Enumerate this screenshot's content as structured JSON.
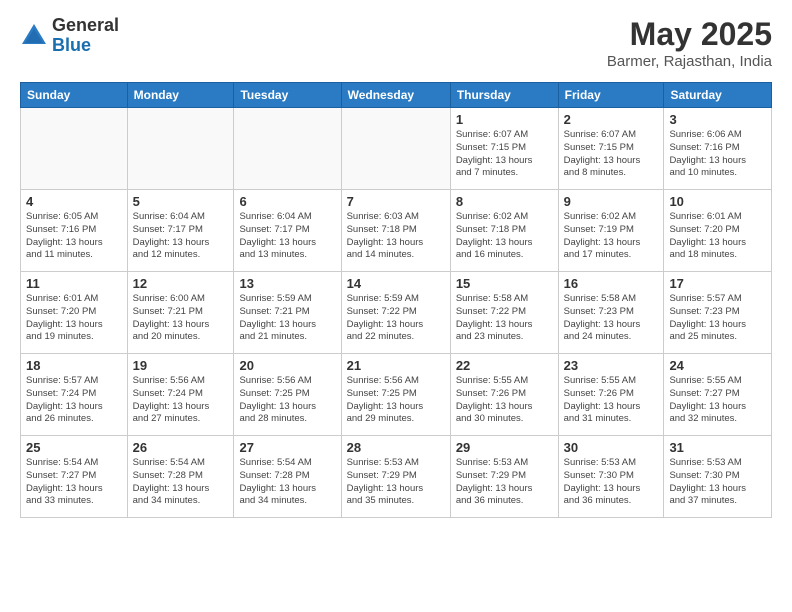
{
  "header": {
    "logo_general": "General",
    "logo_blue": "Blue",
    "month_title": "May 2025",
    "location": "Barmer, Rajasthan, India"
  },
  "weekdays": [
    "Sunday",
    "Monday",
    "Tuesday",
    "Wednesday",
    "Thursday",
    "Friday",
    "Saturday"
  ],
  "weeks": [
    [
      {
        "day": "",
        "info": ""
      },
      {
        "day": "",
        "info": ""
      },
      {
        "day": "",
        "info": ""
      },
      {
        "day": "",
        "info": ""
      },
      {
        "day": "1",
        "info": "Sunrise: 6:07 AM\nSunset: 7:15 PM\nDaylight: 13 hours\nand 7 minutes."
      },
      {
        "day": "2",
        "info": "Sunrise: 6:07 AM\nSunset: 7:15 PM\nDaylight: 13 hours\nand 8 minutes."
      },
      {
        "day": "3",
        "info": "Sunrise: 6:06 AM\nSunset: 7:16 PM\nDaylight: 13 hours\nand 10 minutes."
      }
    ],
    [
      {
        "day": "4",
        "info": "Sunrise: 6:05 AM\nSunset: 7:16 PM\nDaylight: 13 hours\nand 11 minutes."
      },
      {
        "day": "5",
        "info": "Sunrise: 6:04 AM\nSunset: 7:17 PM\nDaylight: 13 hours\nand 12 minutes."
      },
      {
        "day": "6",
        "info": "Sunrise: 6:04 AM\nSunset: 7:17 PM\nDaylight: 13 hours\nand 13 minutes."
      },
      {
        "day": "7",
        "info": "Sunrise: 6:03 AM\nSunset: 7:18 PM\nDaylight: 13 hours\nand 14 minutes."
      },
      {
        "day": "8",
        "info": "Sunrise: 6:02 AM\nSunset: 7:18 PM\nDaylight: 13 hours\nand 16 minutes."
      },
      {
        "day": "9",
        "info": "Sunrise: 6:02 AM\nSunset: 7:19 PM\nDaylight: 13 hours\nand 17 minutes."
      },
      {
        "day": "10",
        "info": "Sunrise: 6:01 AM\nSunset: 7:20 PM\nDaylight: 13 hours\nand 18 minutes."
      }
    ],
    [
      {
        "day": "11",
        "info": "Sunrise: 6:01 AM\nSunset: 7:20 PM\nDaylight: 13 hours\nand 19 minutes."
      },
      {
        "day": "12",
        "info": "Sunrise: 6:00 AM\nSunset: 7:21 PM\nDaylight: 13 hours\nand 20 minutes."
      },
      {
        "day": "13",
        "info": "Sunrise: 5:59 AM\nSunset: 7:21 PM\nDaylight: 13 hours\nand 21 minutes."
      },
      {
        "day": "14",
        "info": "Sunrise: 5:59 AM\nSunset: 7:22 PM\nDaylight: 13 hours\nand 22 minutes."
      },
      {
        "day": "15",
        "info": "Sunrise: 5:58 AM\nSunset: 7:22 PM\nDaylight: 13 hours\nand 23 minutes."
      },
      {
        "day": "16",
        "info": "Sunrise: 5:58 AM\nSunset: 7:23 PM\nDaylight: 13 hours\nand 24 minutes."
      },
      {
        "day": "17",
        "info": "Sunrise: 5:57 AM\nSunset: 7:23 PM\nDaylight: 13 hours\nand 25 minutes."
      }
    ],
    [
      {
        "day": "18",
        "info": "Sunrise: 5:57 AM\nSunset: 7:24 PM\nDaylight: 13 hours\nand 26 minutes."
      },
      {
        "day": "19",
        "info": "Sunrise: 5:56 AM\nSunset: 7:24 PM\nDaylight: 13 hours\nand 27 minutes."
      },
      {
        "day": "20",
        "info": "Sunrise: 5:56 AM\nSunset: 7:25 PM\nDaylight: 13 hours\nand 28 minutes."
      },
      {
        "day": "21",
        "info": "Sunrise: 5:56 AM\nSunset: 7:25 PM\nDaylight: 13 hours\nand 29 minutes."
      },
      {
        "day": "22",
        "info": "Sunrise: 5:55 AM\nSunset: 7:26 PM\nDaylight: 13 hours\nand 30 minutes."
      },
      {
        "day": "23",
        "info": "Sunrise: 5:55 AM\nSunset: 7:26 PM\nDaylight: 13 hours\nand 31 minutes."
      },
      {
        "day": "24",
        "info": "Sunrise: 5:55 AM\nSunset: 7:27 PM\nDaylight: 13 hours\nand 32 minutes."
      }
    ],
    [
      {
        "day": "25",
        "info": "Sunrise: 5:54 AM\nSunset: 7:27 PM\nDaylight: 13 hours\nand 33 minutes."
      },
      {
        "day": "26",
        "info": "Sunrise: 5:54 AM\nSunset: 7:28 PM\nDaylight: 13 hours\nand 34 minutes."
      },
      {
        "day": "27",
        "info": "Sunrise: 5:54 AM\nSunset: 7:28 PM\nDaylight: 13 hours\nand 34 minutes."
      },
      {
        "day": "28",
        "info": "Sunrise: 5:53 AM\nSunset: 7:29 PM\nDaylight: 13 hours\nand 35 minutes."
      },
      {
        "day": "29",
        "info": "Sunrise: 5:53 AM\nSunset: 7:29 PM\nDaylight: 13 hours\nand 36 minutes."
      },
      {
        "day": "30",
        "info": "Sunrise: 5:53 AM\nSunset: 7:30 PM\nDaylight: 13 hours\nand 36 minutes."
      },
      {
        "day": "31",
        "info": "Sunrise: 5:53 AM\nSunset: 7:30 PM\nDaylight: 13 hours\nand 37 minutes."
      }
    ]
  ]
}
